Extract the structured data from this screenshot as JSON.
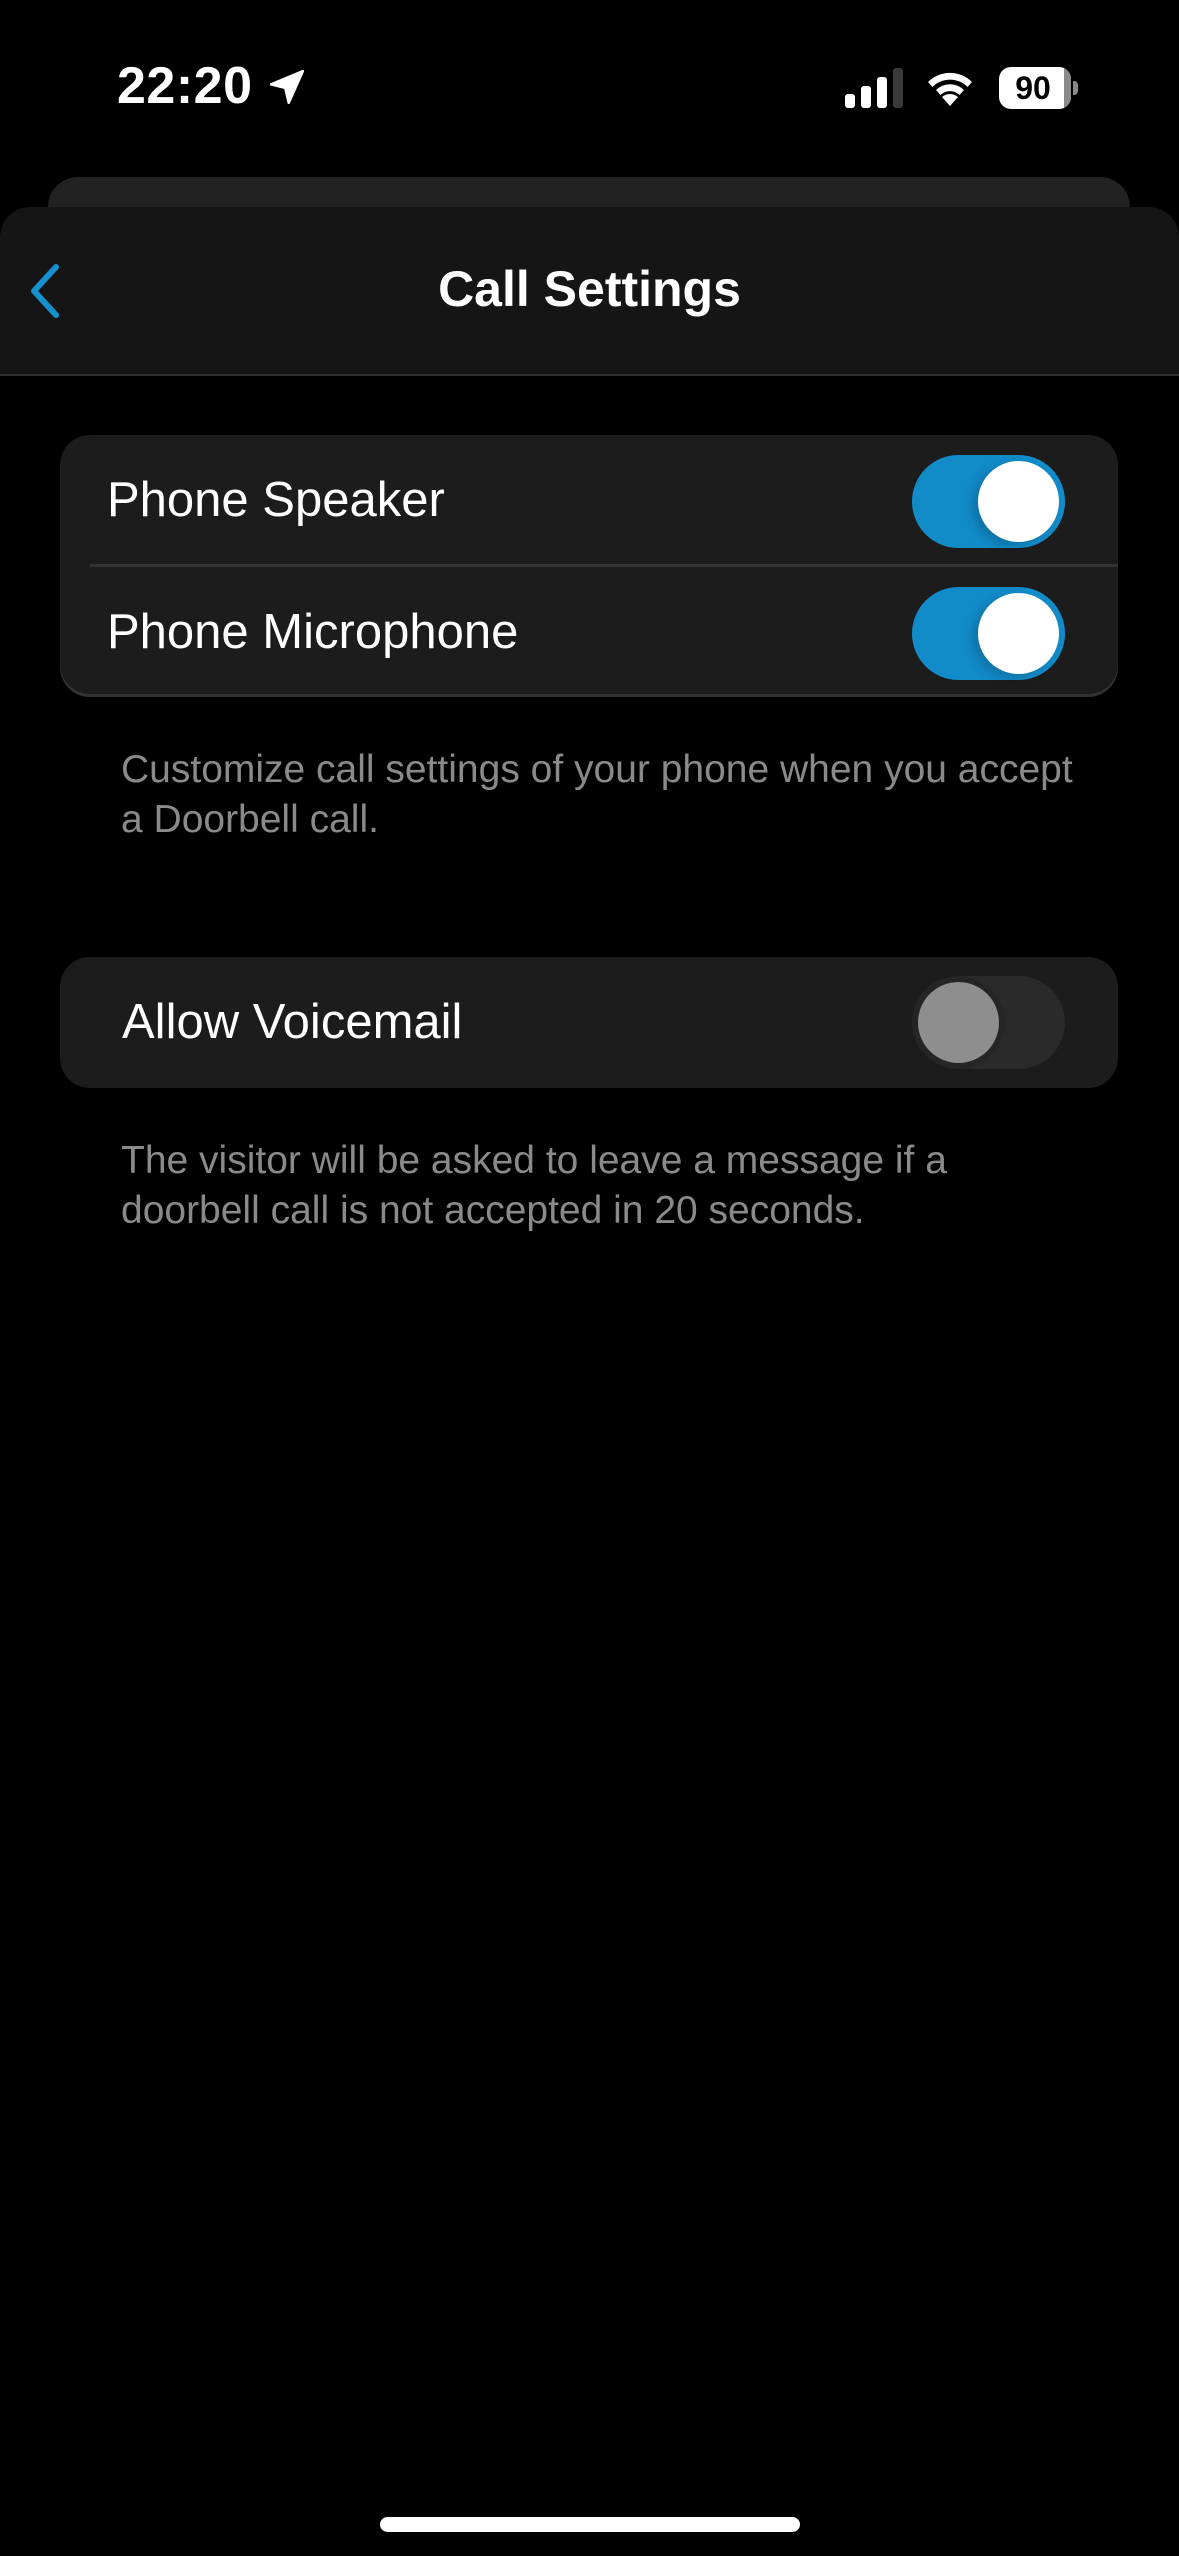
{
  "status_bar": {
    "time": "22:20",
    "location_icon": "location-arrow-icon",
    "signal_icon": "cellular-signal-icon",
    "signal_bars_active": 3,
    "signal_bars_total": 4,
    "wifi_icon": "wifi-icon",
    "battery_level": "90",
    "battery_fraction": 0.9
  },
  "nav": {
    "back_icon": "chevron-left-icon",
    "title": "Call Settings"
  },
  "groups": [
    {
      "rows": [
        {
          "label": "Phone Speaker",
          "toggle_on": true
        },
        {
          "label": "Phone Microphone",
          "toggle_on": true
        }
      ],
      "footer": "Customize call settings of your phone when you accept a Doorbell call."
    },
    {
      "rows": [
        {
          "label": "Allow Voicemail",
          "toggle_on": false
        }
      ],
      "footer": "The visitor will be asked to leave a message if a doorbell call is not accepted in 20 seconds."
    }
  ],
  "colors": {
    "accent": "#128bc9",
    "toggle_off_track": "#2a2a2a",
    "toggle_off_thumb": "#8e8e8e",
    "cell_background": "#1c1c1c",
    "nav_background": "#151515",
    "footer_text": "#8a8a8a",
    "page_background": "#000000"
  }
}
